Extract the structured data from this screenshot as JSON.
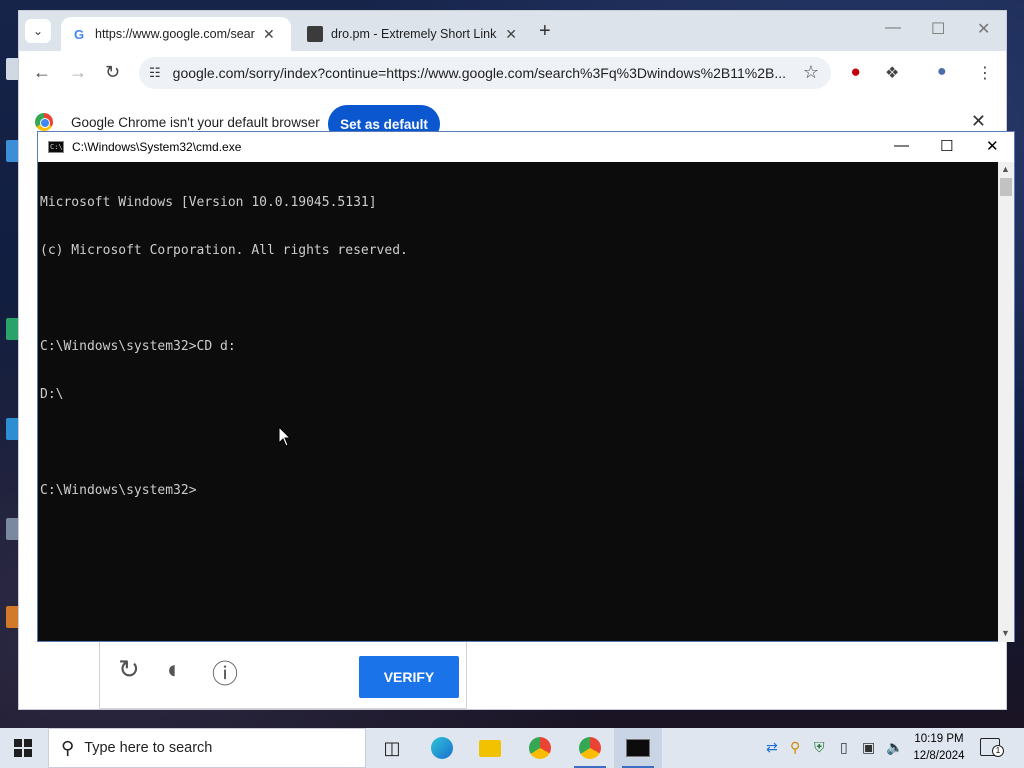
{
  "browser": {
    "tabs": [
      {
        "title": "https://www.google.com/search",
        "active": true,
        "favicon": "google-g-icon"
      },
      {
        "title": "dro.pm - Extremely Short Links",
        "active": false,
        "favicon": "dro-pm-icon"
      }
    ],
    "url": "google.com/sorry/index?continue=https://www.google.com/search%3Fq%3Dwindows%2B11%2B...",
    "infobar": {
      "message": "Google Chrome isn't your default browser",
      "button": "Set as default"
    },
    "captcha": {
      "verify_label": "VERIFY"
    }
  },
  "cmd": {
    "title": "C:\\Windows\\System32\\cmd.exe",
    "lines": [
      "Microsoft Windows [Version 10.0.19045.5131]",
      "(c) Microsoft Corporation. All rights reserved.",
      "",
      "C:\\Windows\\system32>CD d:",
      "D:\\",
      "",
      "C:\\Windows\\system32>"
    ]
  },
  "taskbar": {
    "search_placeholder": "Type here to search",
    "time": "10:19 PM",
    "date": "12/8/2024",
    "notification_count": "1",
    "pinned": [
      "task-view",
      "edge",
      "file-explorer",
      "chrome",
      "chrome",
      "cmd"
    ]
  },
  "colors": {
    "chrome_blue": "#0b57d0",
    "verify_blue": "#1a73e8",
    "console_bg": "#0c0c0c",
    "console_fg": "#cccccc"
  }
}
